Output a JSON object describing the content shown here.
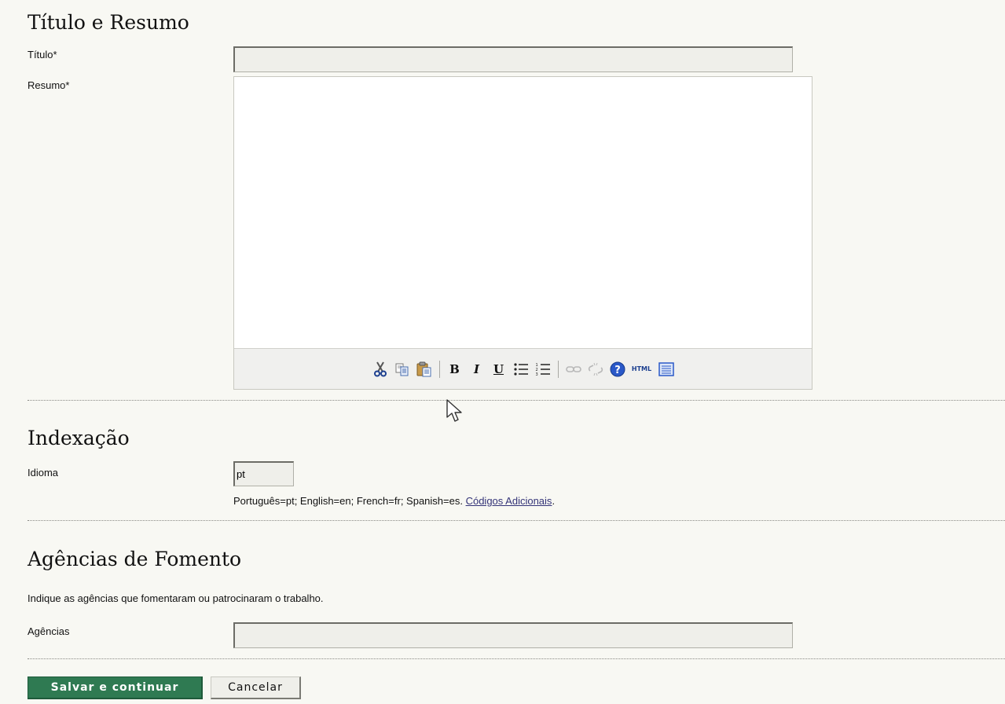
{
  "sections": {
    "title_abstract": {
      "heading": "Título e Resumo",
      "title_label": "Título*",
      "title_value": "",
      "abstract_label": "Resumo*",
      "abstract_value": ""
    },
    "indexing": {
      "heading": "Indexação",
      "language_label": "Idioma",
      "language_value": "pt",
      "hint_text": "Português=pt; English=en; French=fr; Spanish=es. ",
      "hint_link": "Códigos Adicionais",
      "hint_end": "."
    },
    "funding": {
      "heading": "Agências de Fomento",
      "description": "Indique as agências que fomentaram ou patrocinaram o trabalho.",
      "agencies_label": "Agências",
      "agencies_value": ""
    }
  },
  "toolbar": {
    "icons": [
      "cut-icon",
      "copy-icon",
      "paste-icon",
      "bold-icon",
      "italic-icon",
      "underline-icon",
      "bullet-list-icon",
      "numbered-list-icon",
      "link-icon",
      "unlink-icon",
      "help-icon",
      "html-icon",
      "fullscreen-icon"
    ],
    "bold_glyph": "B",
    "italic_glyph": "I",
    "underline_glyph": "U",
    "html_glyph": "HTML"
  },
  "actions": {
    "save_label": "Salvar e continuar",
    "cancel_label": "Cancelar"
  },
  "colors": {
    "background": "#f8f8f3",
    "save_button": "#2f7a52",
    "link": "#333377"
  }
}
